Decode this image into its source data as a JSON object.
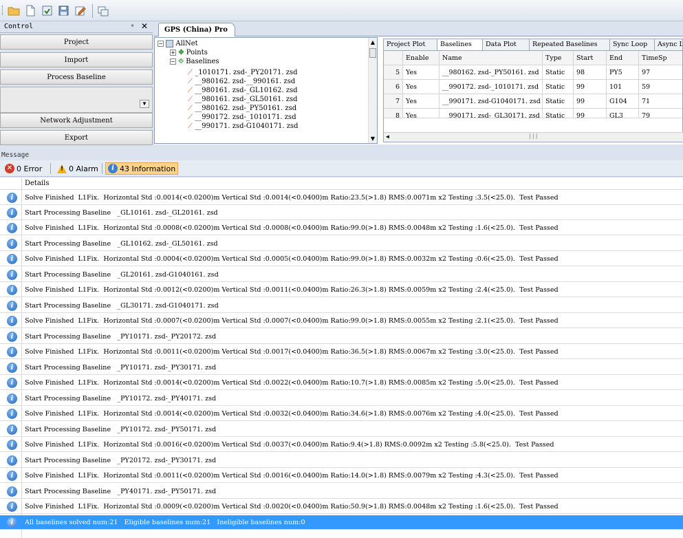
{
  "toolbar": {
    "icons": [
      "open-folder-icon",
      "new-file-icon",
      "import-icon",
      "save-icon",
      "edit-icon",
      "window-icon"
    ]
  },
  "control": {
    "title": "Control",
    "pin": "ᵠ",
    "close": "✕",
    "buttons": [
      "Project",
      "Import",
      "Process Baseline",
      "Network Adjustment",
      "Export"
    ]
  },
  "document_tab": "GPS (China) Pro",
  "tree": {
    "root": "AllNet",
    "points": "Points",
    "baselines": "Baselines",
    "items": [
      "_1010171. zsd-_PY20171. zsd",
      "__980162. zsd-__990161. zsd",
      "__980161. zsd-_GL10162. zsd",
      "__980161. zsd-_GL50161. zsd",
      "__980162. zsd-_PY50161. zsd",
      "__990172. zsd-_1010171. zsd",
      "__990171. zsd-G1040171. zsd"
    ]
  },
  "right_tabs": [
    "Project Plot",
    "Baselines",
    "Data Plot",
    "Repeated Baselines",
    "Sync Loop",
    "Async L"
  ],
  "grid": {
    "headers": [
      "Enable",
      "Name",
      "Type",
      "Start",
      "End",
      "TimeSp"
    ],
    "rows": [
      {
        "num": "5",
        "enable": "Yes",
        "name": "__980162. zsd-_PY50161. zsd",
        "type": "Static",
        "start": "98",
        "end": "PY5",
        "time": "97"
      },
      {
        "num": "6",
        "enable": "Yes",
        "name": "__990172. zsd-_1010171. zsd",
        "type": "Static",
        "start": "99",
        "end": "101",
        "time": "59"
      },
      {
        "num": "7",
        "enable": "Yes",
        "name": "__990171. zsd-G1040171. zsd",
        "type": "Static",
        "start": "99",
        "end": "G104",
        "time": "71"
      },
      {
        "num": "8",
        "enable": "Yes",
        "name": "__990171. zsd-_GL30171. zsd",
        "type": "Static",
        "start": "99",
        "end": "GL3",
        "time": "79"
      }
    ]
  },
  "message": {
    "title": "Message",
    "error_label": "0 Error",
    "alarm_label": "0 Alarm",
    "info_label": "43 Information",
    "details_header": "Details",
    "rows": [
      "Solve Finished  L1Fix.  Horizontal Std :0.0014(<0.0200)m Vertical Std :0.0014(<0.0400)m Ratio:23.5(>1.8) RMS:0.0071m x2 Testing :3.5(<25.0).  Test Passed",
      "Start Processing Baseline   _GL10161. zsd-_GL20161. zsd",
      "Solve Finished  L1Fix.  Horizontal Std :0.0008(<0.0200)m Vertical Std :0.0008(<0.0400)m Ratio:99.0(>1.8) RMS:0.0048m x2 Testing :1.6(<25.0).  Test Passed",
      "Start Processing Baseline   _GL10162. zsd-_GL50161. zsd",
      "Solve Finished  L1Fix.  Horizontal Std :0.0004(<0.0200)m Vertical Std :0.0005(<0.0400)m Ratio:99.0(>1.8) RMS:0.0032m x2 Testing :0.6(<25.0).  Test Passed",
      "Start Processing Baseline   _GL20161. zsd-G1040161. zsd",
      "Solve Finished  L1Fix.  Horizontal Std :0.0012(<0.0200)m Vertical Std :0.0011(<0.0400)m Ratio:26.3(>1.8) RMS:0.0059m x2 Testing :2.4(<25.0).  Test Passed",
      "Start Processing Baseline   _GL30171. zsd-G1040171. zsd",
      "Solve Finished  L1Fix.  Horizontal Std :0.0007(<0.0200)m Vertical Std :0.0007(<0.0400)m Ratio:99.0(>1.8) RMS:0.0055m x2 Testing :2.1(<25.0).  Test Passed",
      "Start Processing Baseline   _PY10171. zsd-_PY20172. zsd",
      "Solve Finished  L1Fix.  Horizontal Std :0.0011(<0.0200)m Vertical Std :0.0017(<0.0400)m Ratio:36.5(>1.8) RMS:0.0067m x2 Testing :3.0(<25.0).  Test Passed",
      "Start Processing Baseline   _PY10171. zsd-_PY30171. zsd",
      "Solve Finished  L1Fix.  Horizontal Std :0.0014(<0.0200)m Vertical Std :0.0022(<0.0400)m Ratio:10.7(>1.8) RMS:0.0085m x2 Testing :5.0(<25.0).  Test Passed",
      "Start Processing Baseline   _PY10172. zsd-_PY40171. zsd",
      "Solve Finished  L1Fix.  Horizontal Std :0.0014(<0.0200)m Vertical Std :0.0032(<0.0400)m Ratio:34.6(>1.8) RMS:0.0076m x2 Testing :4.0(<25.0).  Test Passed",
      "Start Processing Baseline   _PY10172. zsd-_PY50171. zsd",
      "Solve Finished  L1Fix.  Horizontal Std :0.0016(<0.0200)m Vertical Std :0.0037(<0.0400)m Ratio:9.4(>1.8) RMS:0.0092m x2 Testing :5.8(<25.0).  Test Passed",
      "Start Processing Baseline   _PY20172. zsd-_PY30171. zsd",
      "Solve Finished  L1Fix.  Horizontal Std :0.0011(<0.0200)m Vertical Std :0.0016(<0.0400)m Ratio:14.0(>1.8) RMS:0.0079m x2 Testing :4.3(<25.0).  Test Passed",
      "Start Processing Baseline   _PY40171. zsd-_PY50171. zsd",
      "Solve Finished  L1Fix.  Horizontal Std :0.0009(<0.0200)m Vertical Std :0.0020(<0.0400)m Ratio:50.9(>1.8) RMS:0.0048m x2 Testing :1.6(<25.0).  Test Passed",
      "All baselines solved num:21   Eligible baselines num:21   Ineligible baselines num:0"
    ]
  },
  "colors": {
    "selection": "#3399ff",
    "info": "#3d7fd0",
    "error": "#d23c2a",
    "alarm": "#f2b400",
    "active_filter": "#fbd38a"
  }
}
